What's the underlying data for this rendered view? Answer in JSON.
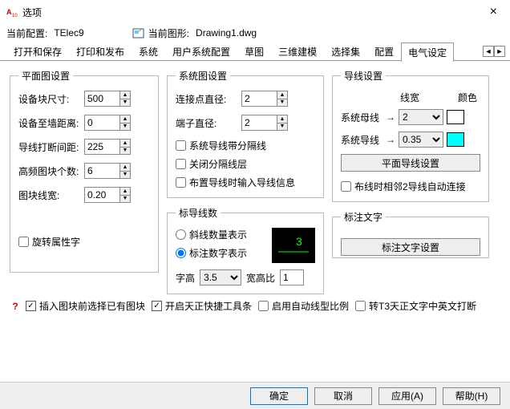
{
  "window": {
    "title": "选项",
    "close": "×"
  },
  "info": {
    "current_profile_label": "当前配置:",
    "current_profile_value": "TElec9",
    "current_drawing_label": "当前图形:",
    "current_drawing_value": "Drawing1.dwg"
  },
  "tabs": {
    "items": [
      "打开和保存",
      "打印和发布",
      "系统",
      "用户系统配置",
      "草图",
      "三维建模",
      "选择集",
      "配置",
      "电气设定"
    ],
    "scroll_left": "◄",
    "scroll_right": "►"
  },
  "plan": {
    "legend": "平面图设置",
    "block_size_label": "设备块尺寸:",
    "block_size_value": "500",
    "wall_dist_label": "设备至墙距离:",
    "wall_dist_value": "0",
    "break_gap_label": "导线打断间距:",
    "break_gap_value": "225",
    "hf_count_label": "高频图块个数:",
    "hf_count_value": "6",
    "block_lw_label": "图块线宽:",
    "block_lw_value": "0.20",
    "rotate_attr_label": "旋转属性字"
  },
  "sys": {
    "legend": "系统图设置",
    "conn_dia_label": "连接点直径:",
    "conn_dia_value": "2",
    "term_dia_label": "端子直径:",
    "term_dia_value": "2",
    "sep_line_label": "系统导线带分隔线",
    "close_sep_label": "关闭分隔线层",
    "layout_input_label": "布置导线时输入导线信息"
  },
  "mark": {
    "legend": "标导线数",
    "slash_label": "斜线数量表示",
    "number_label": "标注数字表示",
    "height_label": "字高",
    "height_value": "3.5",
    "ratio_label": "宽高比",
    "ratio_value": "1",
    "preview_text": "3"
  },
  "wire": {
    "legend": "导线设置",
    "hdr_linewidth": "线宽",
    "hdr_color": "颜色",
    "bus_label": "系统母线",
    "bus_lw": "2",
    "bus_color": "#ff00ff",
    "lead_label": "系统导线",
    "lead_lw": "0.35",
    "lead_color": "#00ffff",
    "plan_wire_btn": "平面导线设置",
    "auto_connect_label": "布线时相邻2导线自动连接"
  },
  "label_text": {
    "legend": "标注文字",
    "btn": "标注文字设置"
  },
  "footer": {
    "pre_select_label": "插入图块前选择已有图块",
    "toolbar_label": "开启天正快捷工具条",
    "auto_ltype_label": "启用自动线型比例",
    "t3_break_label": "转T3天正文字中英文打断"
  },
  "buttons": {
    "ok": "确定",
    "cancel": "取消",
    "apply": "应用(A)",
    "help": "帮助(H)"
  }
}
